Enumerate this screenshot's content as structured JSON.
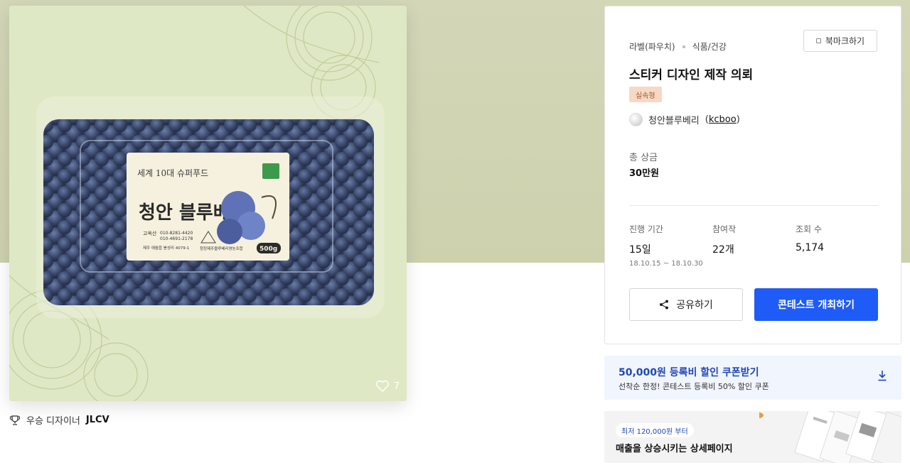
{
  "product": {
    "likes": "7",
    "label": {
      "slogan": "세계 10대 슈퍼푸드",
      "name": "청안 블루베리",
      "farmer": "고옥산",
      "phone1": "010-8281-4420",
      "phone2": "010-4691-2178",
      "address": "제주 애월읍 봉성리 4079-1",
      "weight": "500g",
      "org": "청정제주블루베리영농조합"
    }
  },
  "award": {
    "prefix": "우승 디자이너",
    "designer": "JLCV"
  },
  "panel": {
    "category1": "라벨(파우치)",
    "category2": "식품/건강",
    "bookmark_label": "북마크하기",
    "title": "스티커 디자인 제작 의뢰",
    "tag": "실속형",
    "client_name": "청안블루베리",
    "client_id": "kcboo",
    "prize_label": "총 상금",
    "prize_value": "30만원",
    "stats": {
      "period_label": "진행 기간",
      "period_value": "15일",
      "period_dates": "18.10.15 ~ 18.10.30",
      "entries_label": "참여작",
      "entries_value": "22개",
      "views_label": "조회 수",
      "views_value": "5,174"
    },
    "share_label": "공유하기",
    "host_label": "콘테스트 개최하기"
  },
  "coupon": {
    "title": "50,000원 등록비 할인 쿠폰받기",
    "subtitle": "선착순 한정! 콘테스트 등록비 50% 할인 쿠폰"
  },
  "banner": {
    "pill": "최저 120,000원 부터",
    "title": "매출을 상승시키는 상세페이지"
  },
  "colors": {
    "accent": "#1e5bf7",
    "coupon_text": "#1e47b8",
    "tag_bg": "#f6d8c4",
    "tag_text": "#a5562a",
    "band": "#d3d7b8"
  }
}
